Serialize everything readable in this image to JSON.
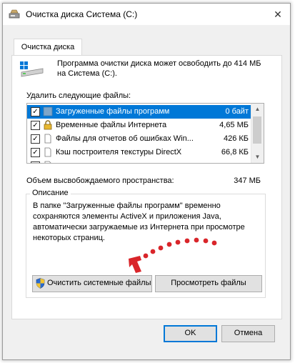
{
  "window": {
    "title": "Очистка диска Система (C:)",
    "close_glyph": "✕"
  },
  "tab": {
    "label": "Очистка диска"
  },
  "info": {
    "text": "Программа очистки диска может освободить до 414 МБ на Система (C:)."
  },
  "list": {
    "label": "Удалить следующие файлы:",
    "items": [
      {
        "checked": true,
        "icon": "folder-icon",
        "name": "Загруженные файлы программ",
        "size": "0 байт",
        "selected": true
      },
      {
        "checked": true,
        "icon": "lock-icon",
        "name": "Временные файлы Интернета",
        "size": "4,65 МБ",
        "selected": false
      },
      {
        "checked": true,
        "icon": "document-icon",
        "name": "Файлы для отчетов об ошибках Win...",
        "size": "426 КБ",
        "selected": false
      },
      {
        "checked": true,
        "icon": "document-icon",
        "name": "Кэш построителя текстуры DirectX",
        "size": "66,8 КБ",
        "selected": false
      },
      {
        "checked": true,
        "icon": "document-icon",
        "name": "",
        "size": "",
        "selected": false
      }
    ]
  },
  "total": {
    "label": "Объем высвобождаемого пространства:",
    "value": "347 МБ"
  },
  "description": {
    "legend": "Описание",
    "text": "В папке \"Загруженные файлы программ\" временно сохраняются элементы ActiveX и приложения Java, автоматически загружаемые из Интернета при просмотре некоторых страниц."
  },
  "buttons": {
    "clean_system": "Очистить системные файлы",
    "view_files": "Просмотреть файлы",
    "ok": "OK",
    "cancel": "Отмена"
  },
  "colors": {
    "selection": "#0078d7",
    "annotation": "#d9252a"
  }
}
